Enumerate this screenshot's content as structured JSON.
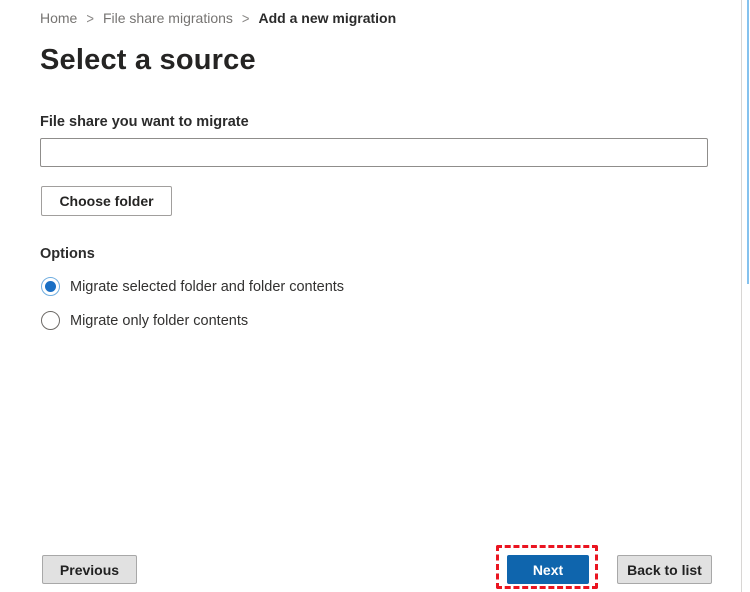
{
  "colors": {
    "primary_button_blue": "#0f65ad",
    "annotation_red": "#ea1420",
    "radio_selected_blue": "#1a6fc4",
    "radio_selected_ring": "#71aee0",
    "secondary_button_gray": "#e1e1e1",
    "scrollbar_blue": "#85c2ee"
  },
  "breadcrumb": {
    "separator": ">",
    "items": [
      {
        "label": "Home"
      },
      {
        "label": "File share migrations"
      },
      {
        "label": "Add a new migration"
      }
    ]
  },
  "page": {
    "title": "Select a source"
  },
  "form": {
    "file_share_label": "File share you want to migrate",
    "file_share_input": {
      "value": "",
      "placeholder": ""
    },
    "choose_folder_label": "Choose folder"
  },
  "options": {
    "label": "Options",
    "items": [
      {
        "label": "Migrate selected folder and folder contents",
        "selected": true
      },
      {
        "label": "Migrate only folder contents",
        "selected": false
      }
    ]
  },
  "footer": {
    "previous_label": "Previous",
    "next_label": "Next",
    "back_to_list_label": "Back to list"
  }
}
